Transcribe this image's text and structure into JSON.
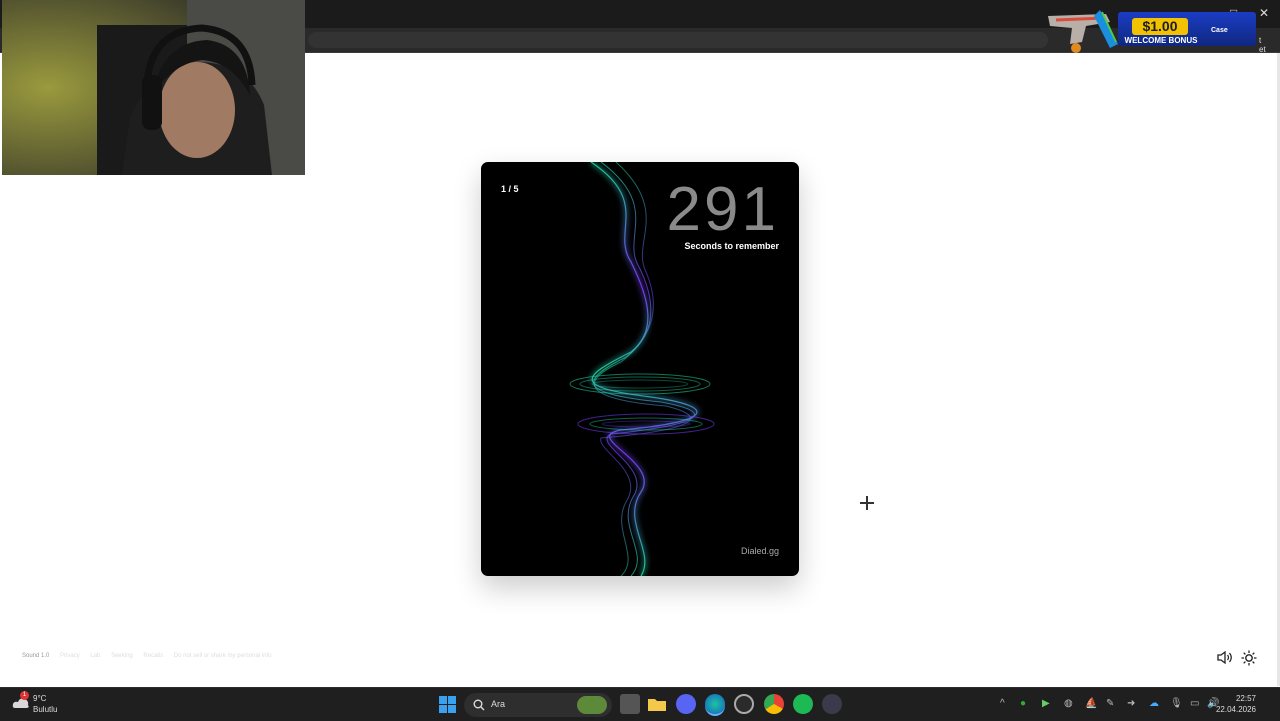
{
  "browser": {
    "window_controls": [
      "–",
      "□",
      "✕"
    ]
  },
  "promo": {
    "amount": "$1.00",
    "label": "WELCOME BONUS",
    "brand": "Case",
    "side_text": "t et"
  },
  "card": {
    "counter": "1 / 5",
    "big_number": "291",
    "subtitle": "Seconds to remember",
    "brand": "Dialed.gg"
  },
  "footer": {
    "links": [
      "Sound 1.0",
      "Privacy",
      "Lab",
      "Seeking",
      "Recalls",
      "Do not sell or share my personal info"
    ]
  },
  "controls": {
    "volume_icon": "speaker-icon",
    "theme_icon": "sun-icon"
  },
  "taskbar": {
    "weather": {
      "temp": "9°C",
      "desc": "Bulutlu",
      "badge": "1"
    },
    "search_label": "Ara",
    "apps": [
      "windows-start-icon",
      "widget-app-icon",
      "file-explorer-icon",
      "folder-icon",
      "discord-icon",
      "edge-icon",
      "obs-icon",
      "chrome-icon",
      "spotify-icon",
      "app-icon"
    ],
    "time": "22:57",
    "date": "22.04.2026"
  },
  "colors": {
    "card_bg": "#000000",
    "wave_green": "#1fd6a0",
    "wave_purple": "#7a3cff",
    "taskbar": "#1f1f1f"
  }
}
